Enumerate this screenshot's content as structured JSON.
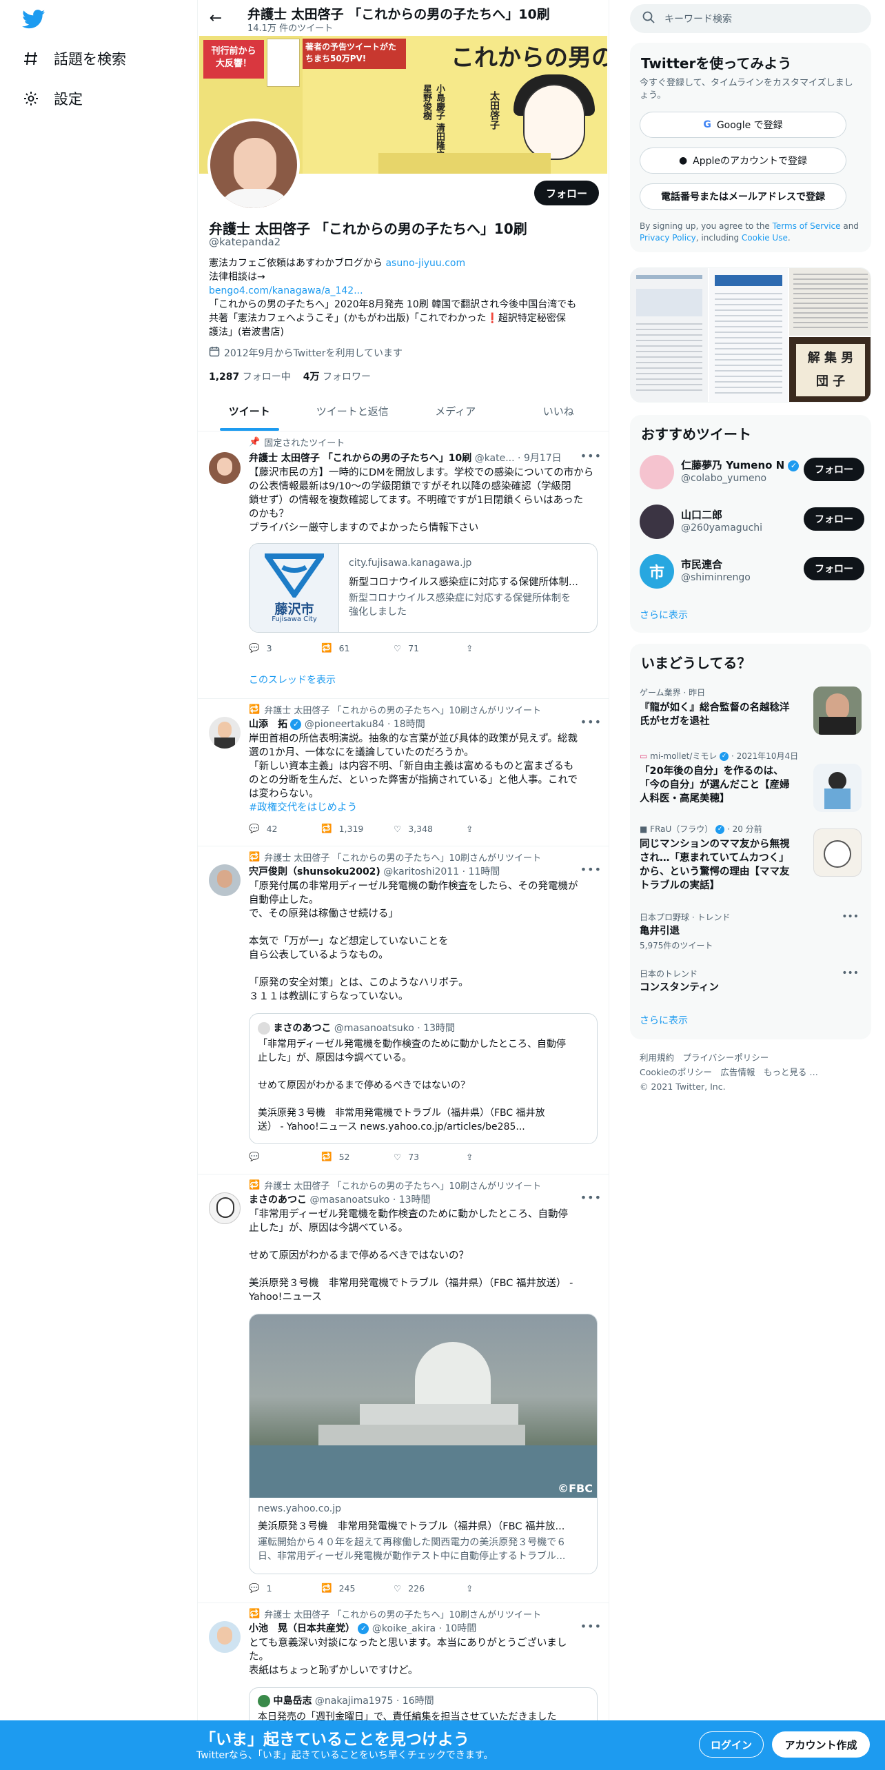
{
  "nav": {
    "explore": "話題を検索",
    "settings": "設定"
  },
  "header": {
    "title": "弁護士 太田啓子 「これからの男の子たちへ」10刷",
    "subtitle": "14.1万 件のツイート"
  },
  "banner": {
    "badge": "刊行前から\n大反響！",
    "pv": "著者の予告ツイートがたちまち50万PV!",
    "title": "これからの男の子たちへ",
    "author": "太田啓子",
    "guests": "小島慶子 清田隆之 星野俊樹"
  },
  "profile": {
    "follow": "フォロー",
    "name": "弁護士 太田啓子 「これからの男の子たちへ」10刷",
    "handle": "@katepanda2",
    "bio1_text": "憲法カフェご依頼はあすわかブログから ",
    "bio1_link": "asuno-jiyuu.com",
    "bio2": "法律相談は→",
    "bio3_link": "bengo4.com/kanagawa/a_142...",
    "bio4": "「これからの男の子たちへ」2020年8月発売 10刷 韓国で翻訳され今後中国台湾でも",
    "bio5": "共著「憲法カフェへようこそ」(かもがわ出版)「これでわかった❗超訳特定秘密保",
    "bio6": "護法」(岩波書店)",
    "joined": "2012年9月からTwitterを利用しています",
    "following_count": "1,287",
    "following_label": "フォロー中",
    "followers_count": "4万",
    "followers_label": "フォロワー"
  },
  "tabs": [
    "ツイート",
    "ツイートと返信",
    "メディア",
    "いいね"
  ],
  "tweets": [
    {
      "context": "固定されたツイート",
      "name": "弁護士 太田啓子 「これからの男の子たちへ」10刷",
      "handle": "@kate...",
      "time": "· 9月17日",
      "lines": [
        "【藤沢市民の方】一時的にDMを開放します。学校での感染についての市から",
        "の公表情報最新は9/10～の学級閉鎖ですがそれ以降の感染確認（学級閉",
        "鎖せず）の情報を複数確認してます。不明確ですが1日閉鎖くらいはあった",
        "のかも？",
        "プライバシー厳守しますのでよかったら情報下さい"
      ],
      "card": {
        "logo_text": "藤沢市",
        "logo_sub": "Fujisawa City",
        "domain": "city.fujisawa.kanagawa.jp",
        "title": "新型コロナウイルス感染症に対応する保健所体制...",
        "desc1": "新型コロナウイルス感染症に対応する保健所体制を",
        "desc2": "強化しました"
      },
      "replies": "3",
      "retweets": "61",
      "likes": "71",
      "thread": "このスレッドを表示"
    },
    {
      "context": "弁護士 太田啓子 「これからの男の子たちへ」10刷さんがリツイート",
      "name": "山添　拓",
      "handle": "@pioneertaku84",
      "time": "· 18時間",
      "lines": [
        "岸田首相の所信表明演説。抽象的な言葉が並び具体的政策が見えず。総裁",
        "選の1か月、一体なにを議論していたのだろうか。",
        "「新しい資本主義」は内容不明、「新自由主義は富めるものと富まざるも",
        "のとの分断を生んだ、といった弊害が指摘されている」と他人事。これで",
        "は変わらない。"
      ],
      "hashtag": "#政権交代をはじめよう",
      "replies": "42",
      "retweets": "1,319",
      "likes": "3,348"
    },
    {
      "context": "弁護士 太田啓子 「これからの男の子たちへ」10刷さんがリツイート",
      "name": "宍戸俊則（shunsoku2002)",
      "handle": "@karitoshi2011",
      "time": "· 11時間",
      "lines": [
        "「原発付属の非常用ディーゼル発電機の動作検査をしたら、その発電機が",
        "自動停止した。",
        "で、その原発は稼働させ続ける」",
        "",
        "本気で「万が一」など想定していないことを",
        "自ら公表しているようなもの。",
        "",
        "「原発の安全対策」とは、このようなハリボテ。",
        "３１１は教訓にすらなっていない。"
      ],
      "quote": {
        "name": "まさのあつこ",
        "handle": "@masanoatsuko",
        "time": "· 13時間",
        "lines": [
          "「非常用ディーゼル発電機を動作検査のために動かしたところ、自動停",
          "止した」が、原因は今調べている。",
          "",
          "せめて原因がわかるまで停めるべきではないの？",
          "",
          "美浜原発３号機　非常用発電機でトラブル（福井県）（FBC 福井放",
          "送） - Yahoo!ニュース news.yahoo.co.jp/articles/be285..."
        ]
      },
      "replies": "",
      "retweets": "52",
      "likes": "73"
    },
    {
      "context": "弁護士 太田啓子 「これからの男の子たちへ」10刷さんがリツイート",
      "name": "まさのあつこ",
      "handle": "@masanoatsuko",
      "time": "· 13時間",
      "lines": [
        "「非常用ディーゼル発電機を動作検査のために動かしたところ、自動停",
        "止した」が、原因は今調べている。",
        "",
        "せめて原因がわかるまで停めるべきではないの？",
        "",
        "美浜原発３号機　非常用発電機でトラブル（福井県）（FBC 福井放送） -",
        "Yahoo!ニュース"
      ],
      "card": {
        "watermark": "©FBC",
        "domain": "news.yahoo.co.jp",
        "title": "美浜原発３号機　非常用発電機でトラブル（福井県）（FBC 福井放...",
        "desc1": "運転開始から４０年を超えて再稼働した関西電力の美浜原発３号機で６",
        "desc2": "日、非常用ディーゼル発電機が動作テスト中に自動停止するトラブル..."
      },
      "replies": "1",
      "retweets": "245",
      "likes": "226"
    },
    {
      "context": "弁護士 太田啓子 「これからの男の子たちへ」10刷さんがリツイート",
      "name": "小池　晃（日本共産党）",
      "handle": "@koike_akira",
      "time": "· 10時間",
      "lines": [
        "とても意義深い対談になったと思います。本当にありがとうございまし",
        "た。",
        "表紙はちょっと恥ずかしいですけど。"
      ],
      "quote": {
        "name": "中島岳志",
        "handle": "@nakajima1975",
        "time": "· 16時間",
        "lines": [
          "本日発売の「週刊金曜日」で、責任編集を担当させていただきました"
        ]
      }
    }
  ],
  "right": {
    "search_placeholder": "キーワード検索",
    "signup_title": "Twitterを使ってみよう",
    "signup_sub": "今すぐ登録して、タイムラインをカスタマイズしましょう。",
    "google": "Google で登録",
    "apple": "Appleのアカウントで登録",
    "phone": "電話番号またはメールアドレスで登録",
    "legal_pre": "By signing up, you agree to the ",
    "terms": "Terms of Service",
    "legal_and": " and ",
    "privacy": "Privacy Policy",
    "legal_inc": ", including ",
    "cookie": "Cookie Use",
    "legal_end": ".",
    "media_text1": "解 集 男",
    "media_text2": "団 子",
    "rec_title": "おすすめツイート",
    "recs": [
      {
        "name": "仁藤夢乃 Yumeno N",
        "handle": "@colabo_yumeno",
        "btn": "フォロー"
      },
      {
        "name": "山口二郎",
        "handle": "@260yamaguchi",
        "btn": "フォロー"
      },
      {
        "name": "市民連合",
        "handle": "@shiminrengo",
        "btn": "フォロー",
        "avatar_text": "市"
      }
    ],
    "show_more": "さらに表示",
    "trends_title": "いまどうしてる？",
    "trends": [
      {
        "meta": "ゲーム業界 · 昨日",
        "title1": "『龍が如く』総合監督の名越稔洋",
        "title2": "氏がセガを退社"
      },
      {
        "meta_src": "mi-mollet/ミモレ",
        "meta_time": "· 2021年10月4日",
        "title1": "「20年後の自分」を作るのは、",
        "title2": "「今の自分」が選んだこと【産婦",
        "title3": "人科医・高尾美穂】"
      },
      {
        "meta_src": "FRaU（フラウ）",
        "meta_time": "· 20 分前",
        "title1": "同じマンションのママ友から無視",
        "title2": "され…「恵まれていてムカつく」",
        "title3": "から、という驚愕の理由【ママ友",
        "title4": "トラブルの実話】"
      },
      {
        "meta": "日本プロ野球 · トレンド",
        "title1": "亀井引退",
        "count": "5,975件のツイート"
      },
      {
        "meta": "日本のトレンド",
        "title1": "コンスタンティン"
      }
    ],
    "footer1": "利用規約　プライバシーポリシー",
    "footer2": "Cookieのポリシー　広告情報　もっと見る …",
    "footer3": "© 2021 Twitter, Inc."
  },
  "bottom": {
    "headline": "「いま」起きていることを見つけよう",
    "sub": "Twitterなら、「いま」起きていることをいち早くチェックできます。",
    "login": "ログイン",
    "signup": "アカウント作成"
  },
  "colors": {
    "accent": "#1d9bf0",
    "text": "#0f1419",
    "muted": "#536471",
    "bottom_bar": "#1d9bf0"
  }
}
